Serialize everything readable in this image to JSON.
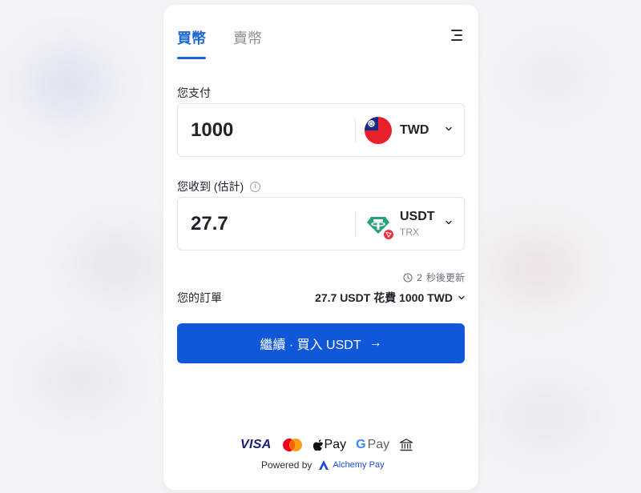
{
  "tabs": [
    {
      "label": "買幣",
      "active": true
    },
    {
      "label": "賣幣",
      "active": false
    }
  ],
  "pay": {
    "label": "您支付",
    "amount": "1000",
    "currency": "TWD",
    "flag_icon": "taiwan-flag-icon"
  },
  "receive": {
    "label": "您收到 (估計)",
    "info_glyph": "i",
    "amount": "27.7",
    "currency": "USDT",
    "network": "TRX",
    "token_icon": "tether-icon"
  },
  "refresh": {
    "seconds": "2",
    "text": "秒後更新"
  },
  "order": {
    "label": "您的訂單",
    "summary": "27.7 USDT 花費 1000 TWD"
  },
  "continue_button": {
    "label": "繼續 · 買入 USDT",
    "arrow": "→"
  },
  "payment_methods": {
    "visa": "VISA",
    "apple_pay": "Pay",
    "google_pay_g": "G",
    "google_pay": "Pay"
  },
  "powered_by": {
    "label": "Powered by",
    "brand": "Alchemy Pay"
  },
  "colors": {
    "accent": "#1158d8",
    "tab_active": "#1967d2",
    "tether": "#26a17b",
    "trx": "#e8313a"
  }
}
